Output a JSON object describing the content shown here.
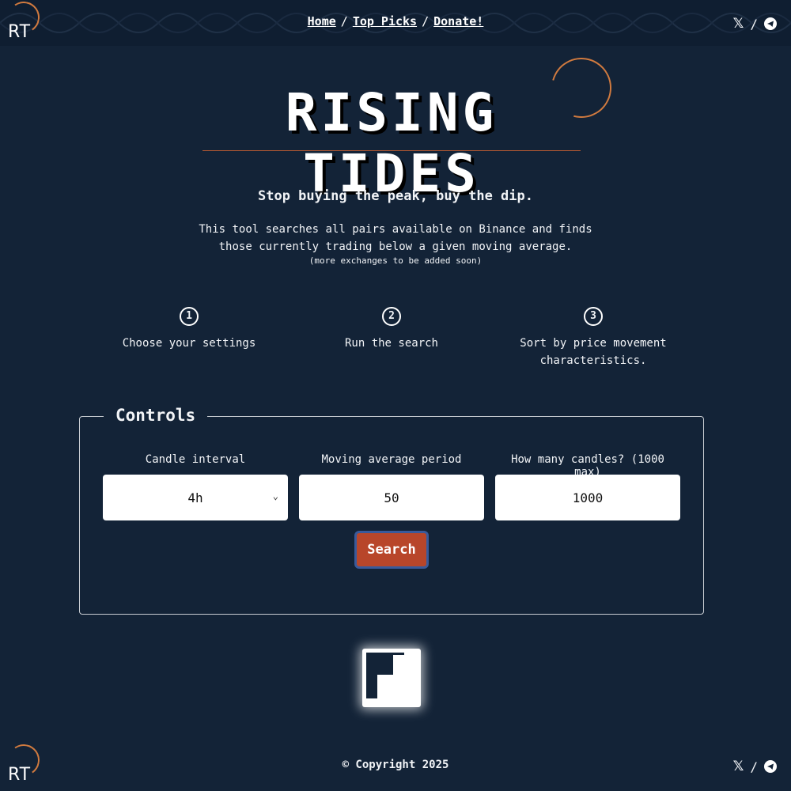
{
  "header": {
    "logo_text": "RT",
    "nav": [
      {
        "label": "Home"
      },
      {
        "label": "Top Picks"
      },
      {
        "label": "Donate!"
      }
    ],
    "nav_separator": "/",
    "social_separator": "/",
    "social_icons": [
      "x-icon",
      "telegram-icon"
    ]
  },
  "hero": {
    "title": "RISING TIDES",
    "tagline": "Stop buying the peak, buy the dip.",
    "description": "This tool searches all pairs available on Binance and finds those currently trading below a given moving average.",
    "note": "(more exchanges to be added soon)"
  },
  "steps": [
    {
      "number": "1",
      "label": "Choose your settings"
    },
    {
      "number": "2",
      "label": "Run the search"
    },
    {
      "number": "3",
      "label": "Sort by price movement characteristics."
    }
  ],
  "controls": {
    "legend": "Controls",
    "candle_interval": {
      "label": "Candle interval",
      "value": "4h"
    },
    "ma_period": {
      "label": "Moving average period",
      "value": "50"
    },
    "candles": {
      "label": "How many candles? (1000 max)",
      "value": "1000"
    },
    "search_label": "Search"
  },
  "footer": {
    "logo_text": "RT",
    "copyright": "© Copyright 2025"
  },
  "colors": {
    "background": "#132337",
    "header_bg": "#0f1e31",
    "accent_orange": "#d07a3f",
    "button": "#b8462a",
    "button_border": "#3a5a9a"
  }
}
